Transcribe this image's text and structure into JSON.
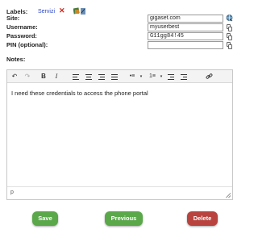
{
  "colors": {
    "tag_link": "#2a46c9",
    "delete_x": "#d1271b",
    "save_green": "#5aa84a",
    "previous_green": "#5aa84a",
    "delete_red": "#b9443f"
  },
  "form": {
    "labels_label": "Labels:",
    "tag": "Servizi",
    "site_label": "Site:",
    "site_value": "gigaset.com",
    "username_label": "Username:",
    "username_value": "myuserbest",
    "password_label": "Password:",
    "password_value": "G11gg84!45",
    "pin_label": "PIN (optional):",
    "pin_value": "",
    "notes_label": "Notes:"
  },
  "editor": {
    "toolbar": {
      "undo": "↶",
      "redo": "↷",
      "bold": "B",
      "italic": "I",
      "bullet_list": "•≡",
      "numbered_list": "1≡",
      "link": "🔗"
    },
    "content": "I need these credentials to access the phone portal",
    "path": "p"
  },
  "buttons": {
    "save": "Save",
    "previous": "Previous",
    "delete": "Delete"
  },
  "icons": [
    "delete-tag-icon",
    "label-tags-icon",
    "edit-labels-icon",
    "open-site-icon",
    "copy-icon"
  ]
}
